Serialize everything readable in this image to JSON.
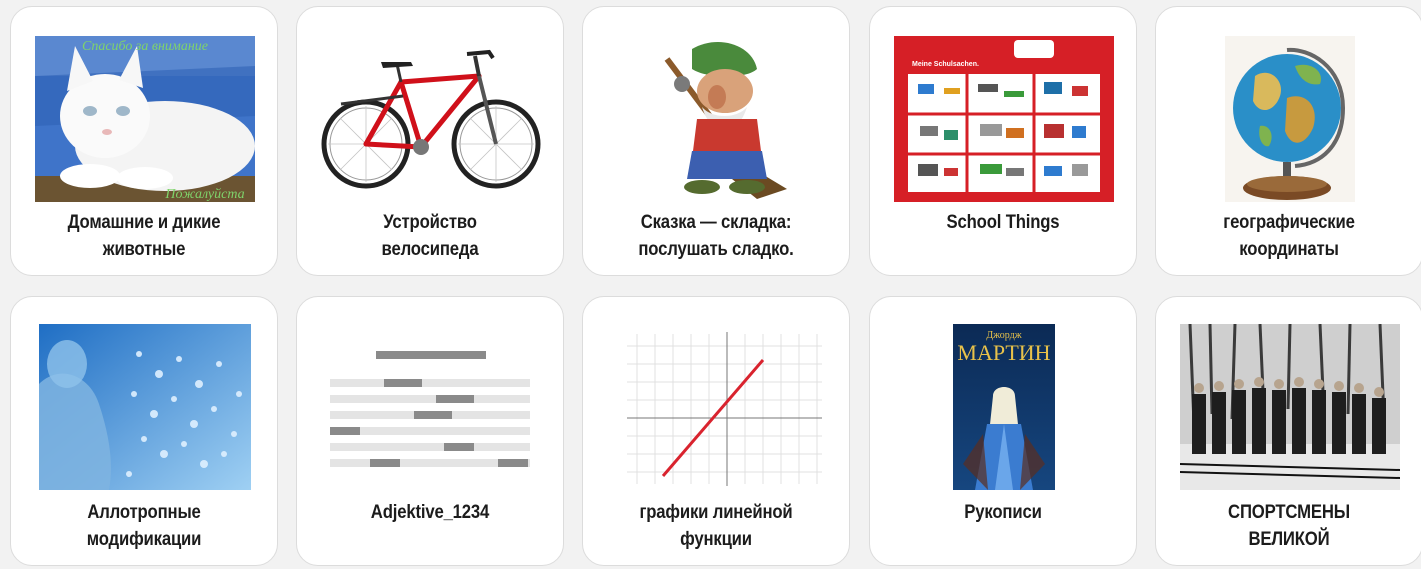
{
  "cards": [
    {
      "title": "Домашние и дикие\nживотные",
      "icon": "white-cat-photo",
      "overlay_top": "Спасибо за внимание",
      "overlay_bottom": "Пожалуйста"
    },
    {
      "title": "Устройство\nвелосипеда",
      "icon": "red-bicycle-photo"
    },
    {
      "title": "Сказка — складка:\nпослушать сладко.",
      "icon": "fairy-tale-character-illustration"
    },
    {
      "title": "School Things",
      "icon": "school-supplies-poster",
      "poster_header": "Meine Schulsachen."
    },
    {
      "title": "географические\nкоординаты",
      "icon": "globe-photo"
    },
    {
      "title": "Аллотропные\nмодификации",
      "icon": "blue-woman-bubbles-image"
    },
    {
      "title": "Adjektive_1234",
      "icon": "fill-in-exercise-diagram"
    },
    {
      "title": "графики линейной\nфункции",
      "icon": "linear-function-graph"
    },
    {
      "title": "Рукописи",
      "icon": "book-cover",
      "book_author": "Джордж",
      "book_title": "МАРТИН"
    },
    {
      "title": "СПОРТСМЕНЫ\nВЕЛИКОЙ",
      "icon": "skiers-archival-photo"
    }
  ],
  "colors": {
    "page_bg": "#f2f2f2",
    "card_bg": "#ffffff",
    "card_border": "#dcdcdc",
    "title_text": "#1c1c1c",
    "poster_red": "#d61f26",
    "graph_line": "#d9232e"
  }
}
